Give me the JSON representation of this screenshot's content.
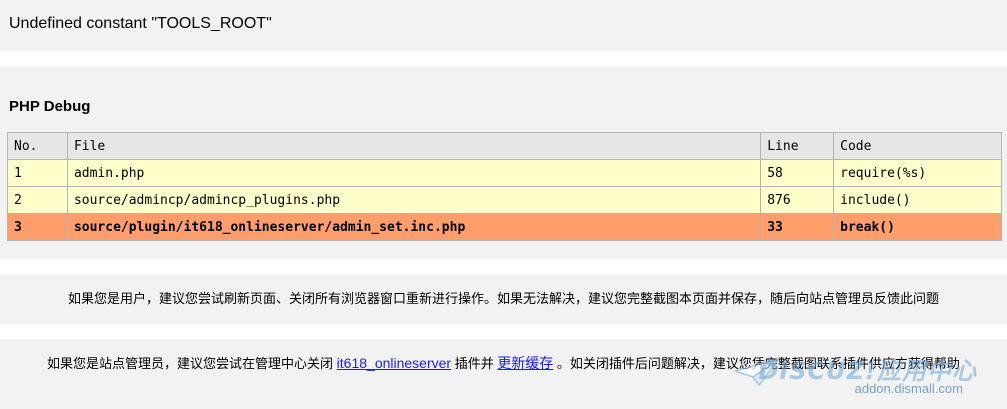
{
  "error": {
    "message": "Undefined constant \"TOOLS_ROOT\""
  },
  "debug": {
    "title": "PHP Debug",
    "headers": [
      "No.",
      "File",
      "Line",
      "Code"
    ],
    "rows": [
      {
        "no": "1",
        "file": "admin.php",
        "line": "58",
        "code": "require(%s)"
      },
      {
        "no": "2",
        "file": "source/admincp/admincp_plugins.php",
        "line": "876",
        "code": "include()"
      },
      {
        "no": "3",
        "file": "source/plugin/it618_onlineserver/admin_set.inc.php",
        "line": "33",
        "code": "break()"
      }
    ]
  },
  "tip": {
    "user_text": "如果您是用户，建议您尝试刷新页面、关闭所有浏览器窗口重新进行操作。如果无法解决，建议您完整截图本页面并保存，随后向站点管理员反馈此问题"
  },
  "admin": {
    "text_before": "如果您是站点管理员，建议您尝试在管理中心关闭 ",
    "plugin_link": "it618_onlineserver",
    "text_mid": " 插件并 ",
    "cache_link": "更新缓存",
    "text_after": " 。如关闭插件后问题解决，建议您凭完整截图联系插件供应方获得帮助"
  },
  "watermark": {
    "logo": "DISCUZ!应用中心",
    "url": "addon.dismall.com"
  }
}
